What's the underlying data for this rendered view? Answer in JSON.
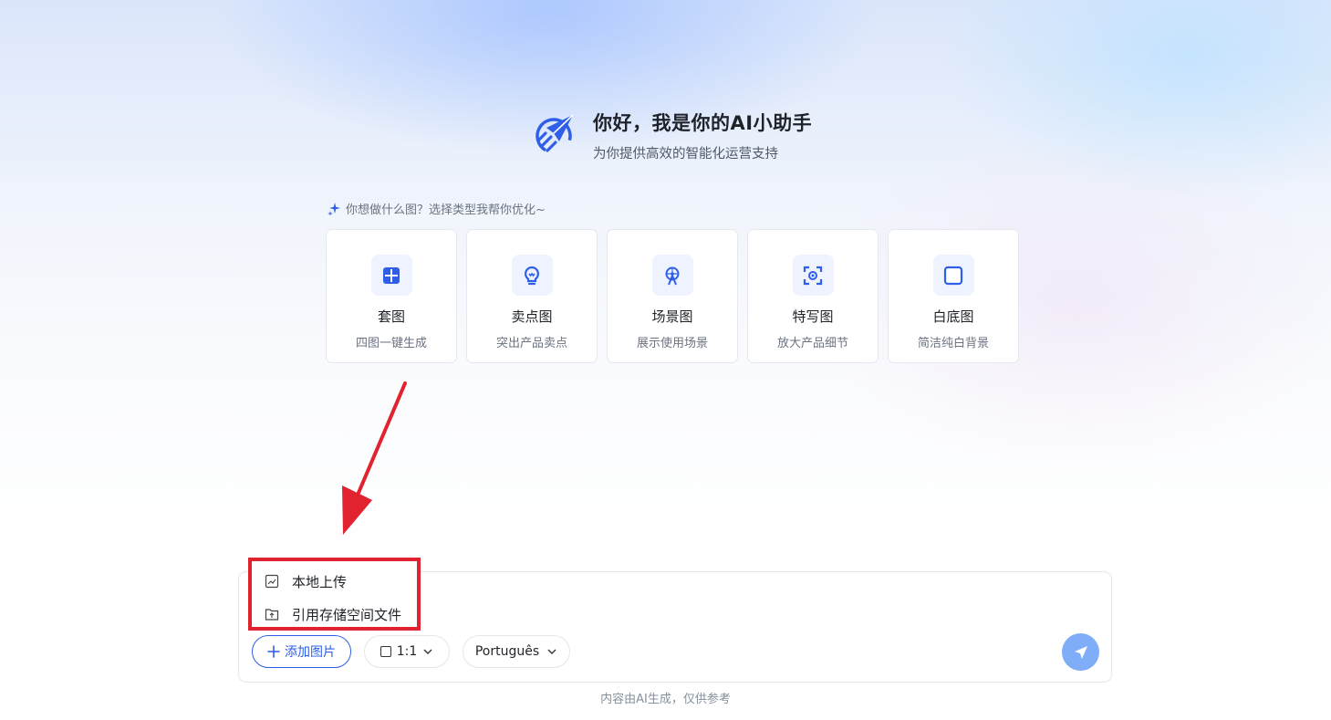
{
  "hero": {
    "title": "你好，我是你的AI小助手",
    "subtitle": "为你提供高效的智能化运营支持",
    "logo_icon": "rocket-logo-icon"
  },
  "prompt": {
    "hint": "你想做什么图？选择类型我帮你优化~",
    "hint_icon": "sparkle-icon"
  },
  "cards": [
    {
      "title": "套图",
      "desc": "四图一键生成",
      "icon": "grid-icon"
    },
    {
      "title": "卖点图",
      "desc": "突出产品卖点",
      "icon": "lightbulb-icon"
    },
    {
      "title": "场景图",
      "desc": "展示使用场景",
      "icon": "scene-icon"
    },
    {
      "title": "特写图",
      "desc": "放大产品细节",
      "icon": "focus-icon"
    },
    {
      "title": "白底图",
      "desc": "简洁纯白背景",
      "icon": "square-icon"
    }
  ],
  "upload_menu": {
    "items": [
      {
        "label": "本地上传",
        "icon": "image-icon"
      },
      {
        "label": "引用存储空间文件",
        "icon": "folder-upload-icon"
      }
    ]
  },
  "toolbar": {
    "add_image_label": "添加图片",
    "ratio_label": "1:1",
    "language_label": "Português"
  },
  "footer": {
    "note": "内容由AI生成，仅供参考"
  },
  "colors": {
    "accent": "#2f5fe8",
    "send_button": "#7fadf7",
    "annotation_red": "#e1232f"
  }
}
